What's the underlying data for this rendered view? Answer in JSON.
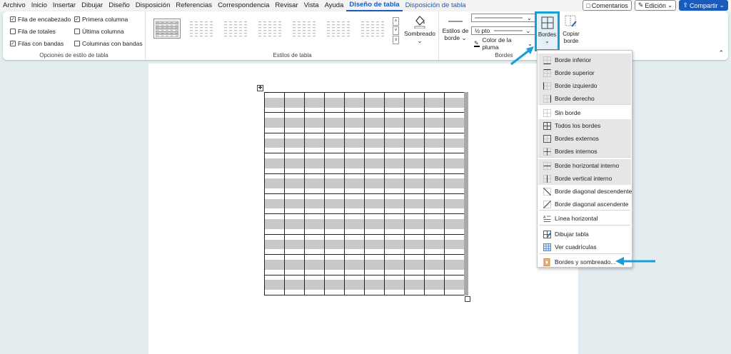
{
  "menu": {
    "tabs": [
      "Archivo",
      "Inicio",
      "Insertar",
      "Dibujar",
      "Diseño",
      "Disposición",
      "Referencias",
      "Correspondencia",
      "Revisar",
      "Vista",
      "Ayuda",
      "Diseño de tabla",
      "Disposición de tabla"
    ],
    "active_tab": "Diseño de tabla",
    "right": {
      "comments": "Comentarios",
      "editing": "Edición",
      "share": "Compartir"
    }
  },
  "style_options": {
    "group_label": "Opciones de estilo de tabla",
    "items": [
      {
        "label": "Fila de encabezado",
        "checked": true
      },
      {
        "label": "Primera columna",
        "checked": true
      },
      {
        "label": "Fila de totales",
        "checked": false
      },
      {
        "label": "Última columna",
        "checked": false
      },
      {
        "label": "Filas con bandas",
        "checked": true
      },
      {
        "label": "Columnas con bandas",
        "checked": false
      }
    ]
  },
  "table_styles": {
    "group_label": "Estilos de tabla",
    "shading": "Sombreado"
  },
  "borders": {
    "group_label": "Bordes",
    "styles_label_1": "Estilos de",
    "styles_label_2": "borde",
    "weight": "½ pto",
    "pen_color": "Color de la pluma",
    "bordes_label": "Bordes",
    "copy_1": "Copiar",
    "copy_2": "borde"
  },
  "dropdown": {
    "items": [
      {
        "label": "Borde inferior",
        "icon": "border-bottom-icon"
      },
      {
        "label": "Borde superior",
        "icon": "border-top-icon"
      },
      {
        "label": "Borde izquierdo",
        "icon": "border-left-icon"
      },
      {
        "label": "Borde derecho",
        "icon": "border-right-icon"
      },
      {
        "label": "Sin borde",
        "icon": "no-border-icon"
      },
      {
        "label": "Todos los bordes",
        "icon": "all-borders-icon"
      },
      {
        "label": "Bordes externos",
        "icon": "outside-borders-icon"
      },
      {
        "label": "Bordes internos",
        "icon": "inside-borders-icon"
      },
      {
        "label": "Borde horizontal interno",
        "icon": "inside-horizontal-icon"
      },
      {
        "label": "Borde vertical interno",
        "icon": "inside-vertical-icon"
      },
      {
        "label": "Borde diagonal descendente",
        "icon": "diagonal-down-icon"
      },
      {
        "label": "Borde diagonal ascendente",
        "icon": "diagonal-up-icon"
      },
      {
        "label": "Línea horizontal",
        "icon": "horizontal-line-icon"
      },
      {
        "label": "Dibujar tabla",
        "icon": "draw-table-icon"
      },
      {
        "label": "Ver cuadrículas",
        "icon": "view-gridlines-icon"
      },
      {
        "label": "Bordes y sombreado...",
        "icon": "borders-shading-icon"
      }
    ]
  },
  "colors": {
    "accent": "#185abd",
    "highlight": "#1a9ed8"
  }
}
